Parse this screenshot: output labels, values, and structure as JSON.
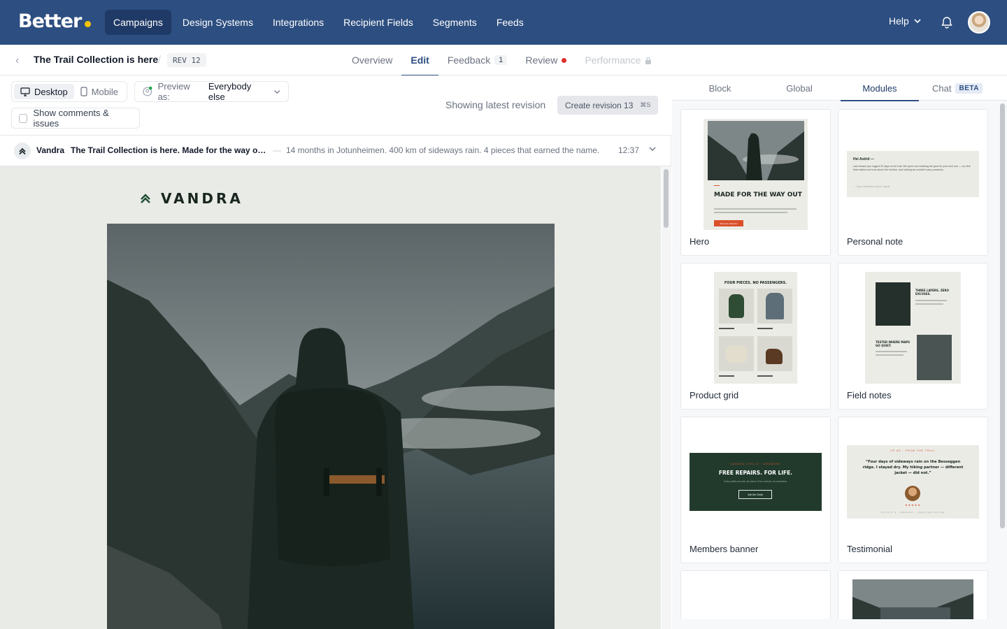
{
  "app": {
    "logo": "Better"
  },
  "nav": {
    "items": [
      {
        "label": "Campaigns",
        "active": true
      },
      {
        "label": "Design Systems"
      },
      {
        "label": "Integrations"
      },
      {
        "label": "Recipient Fields"
      },
      {
        "label": "Segments"
      },
      {
        "label": "Feeds"
      }
    ],
    "help": "Help"
  },
  "campaign": {
    "title": "The Trail Collection is here",
    "revision_badge": "REV 12",
    "tabs": [
      {
        "label": "Overview"
      },
      {
        "label": "Edit",
        "active": true
      },
      {
        "label": "Feedback",
        "count": "1"
      },
      {
        "label": "Review",
        "status": "red-dot"
      },
      {
        "label": "Performance",
        "disabled": true,
        "icon": "lock-icon"
      }
    ]
  },
  "toolbar": {
    "desktop": "Desktop",
    "mobile": "Mobile",
    "preview_label": "Preview as:",
    "preview_value": "Everybody else",
    "show_comments": "Show comments & issues",
    "latest_text": "Showing latest revision",
    "create_revision": "Create revision 13",
    "create_shortcut": "⌘S"
  },
  "email": {
    "sender": "Vandra",
    "subject": "The Trail Collection is here. Made for the way out.",
    "preheader": "14 months in Jotunheimen. 400 km of sideways rain. 4 pieces that earned the name.",
    "time": "12:37",
    "brand": "VANDRA"
  },
  "right_panel": {
    "tabs": [
      {
        "label": "Block"
      },
      {
        "label": "Global"
      },
      {
        "label": "Modules",
        "active": true
      },
      {
        "label": "Chat",
        "badge": "BETA"
      }
    ],
    "modules": [
      {
        "label": "Hero",
        "thumb_title": "MADE FOR THE WAY OUT",
        "thumb_button": "Shop the collection"
      },
      {
        "label": "Personal note",
        "thumb_greeting": "Hei Astrid —",
        "thumb_body": "Last season you logged 33 days on the trail. We spent ours building the gear for your next one — our first three fabrics we trust above the treeline, and nothing we wouldn't carry ourselves.",
        "thumb_sign": "— THE VANDRA FIELD TEAM"
      },
      {
        "label": "Product grid",
        "thumb_title": "FOUR PIECES. NO PASSENGERS."
      },
      {
        "label": "Field notes",
        "thumb_title_1": "THREE LAYERS. ZERO EXCUSES.",
        "thumb_title_2": "TESTED WHERE MAPS GO QUIET."
      },
      {
        "label": "Members banner",
        "thumb_kicker": "VANDRA CIRCLE · MEMBERS",
        "thumb_title": "FREE REPAIRS. FOR LIFE.",
        "thumb_body": "Every stitch we sell, we mend. Free, forever, for members.",
        "thumb_button": "Join the Circle"
      },
      {
        "label": "Testimonial",
        "thumb_kicker": "UP AS · FROM THE TRAIL",
        "thumb_quote": "“Four days of sideways rain on the Besseggen ridge. I stayed dry. My hiking partner — different jacket — did not.”",
        "thumb_author": "ASTRID H · BERGEN · VERIFIED BUYER",
        "stars": 5
      },
      {
        "label": ""
      },
      {
        "label": ""
      }
    ]
  },
  "colors": {
    "nav_bg": "#2d4e80",
    "nav_active": "#1f3a66",
    "accent_yellow": "#f4c20d",
    "review_dot": "#e02d2d",
    "brand_dark": "#1a2620",
    "members_green": "#213a2c",
    "cta_orange": "#d9502b"
  }
}
